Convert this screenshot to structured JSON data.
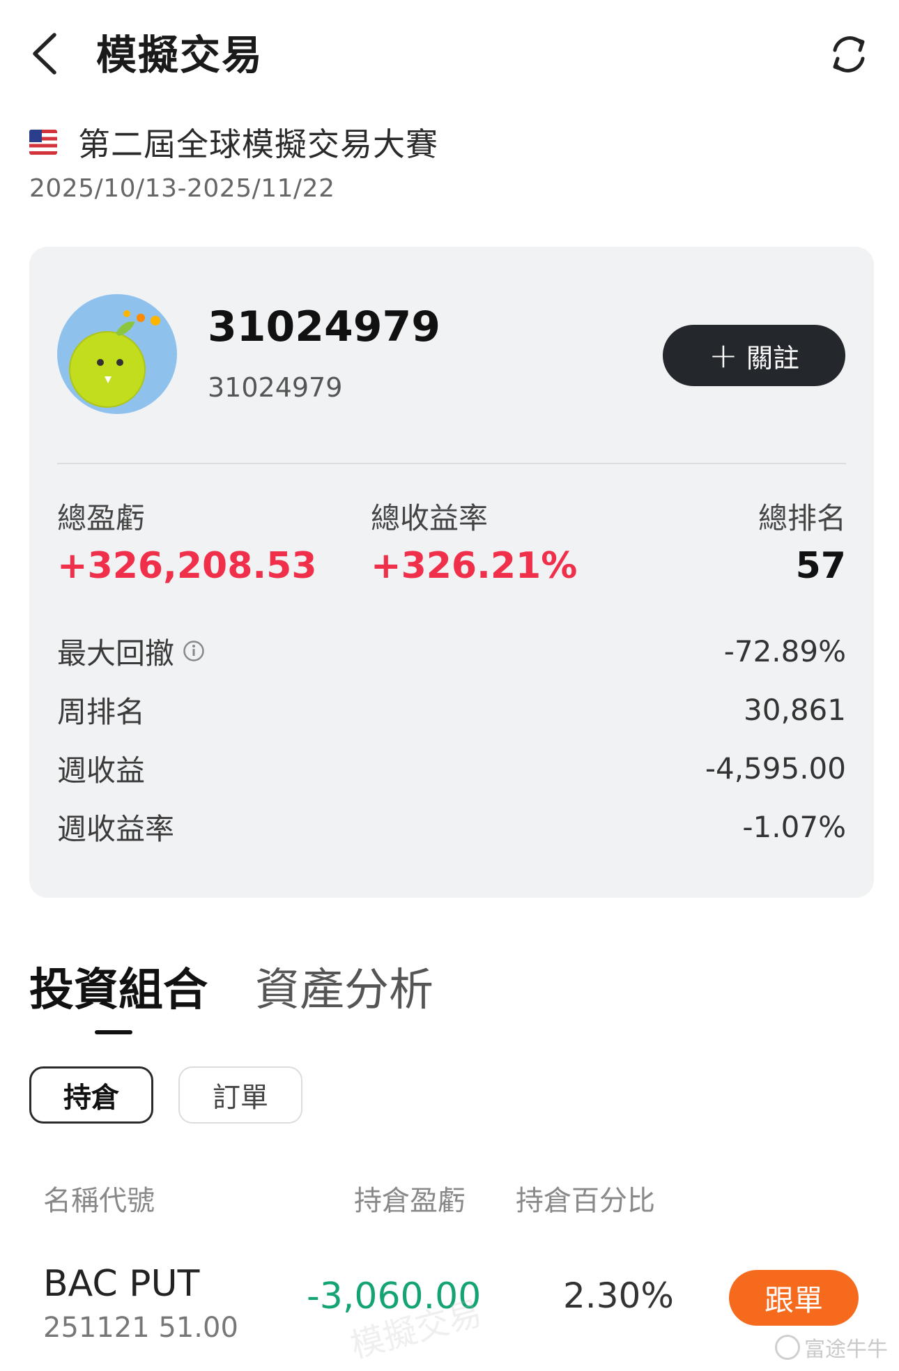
{
  "header": {
    "title": "模擬交易",
    "back_icon": "chevron-left-icon",
    "refresh_icon": "refresh-icon"
  },
  "contest": {
    "flag_icon": "us-flag-icon",
    "name": "第二屆全球模擬交易大賽",
    "date_range": "2025/10/13-2025/11/22"
  },
  "profile": {
    "name": "31024979",
    "id": "31024979",
    "follow_label": "關註",
    "follow_plus": "+"
  },
  "stats": {
    "total_pl_label": "總盈虧",
    "total_pl_value": "+326,208.53",
    "total_return_label": "總收益率",
    "total_return_value": "+326.21%",
    "total_rank_label": "總排名",
    "total_rank_value": "57"
  },
  "metrics": {
    "max_drawdown_label": "最大回撤",
    "max_drawdown_value": "-72.89%",
    "weekly_rank_label": "周排名",
    "weekly_rank_value": "30,861",
    "weekly_pl_label": "週收益",
    "weekly_pl_value": "-4,595.00",
    "weekly_return_label": "週收益率",
    "weekly_return_value": "-1.07%"
  },
  "tabs": {
    "portfolio": "投資組合",
    "asset_analysis": "資產分析"
  },
  "sub_tabs": {
    "positions": "持倉",
    "orders": "訂單"
  },
  "table": {
    "col_name": "名稱代號",
    "col_pl": "持倉盈虧",
    "col_pct": "持倉百分比",
    "rows": [
      {
        "name": "BAC PUT",
        "sub": "251121 51.00",
        "pl": "-3,060.00",
        "pct": "2.30%",
        "action": "跟單"
      }
    ]
  },
  "watermark": "模擬交易",
  "brand": "富途牛牛",
  "colors": {
    "gain": "#f0304a",
    "loss": "#14a472",
    "accent": "#f56a1c",
    "dark_button": "#24272c"
  }
}
